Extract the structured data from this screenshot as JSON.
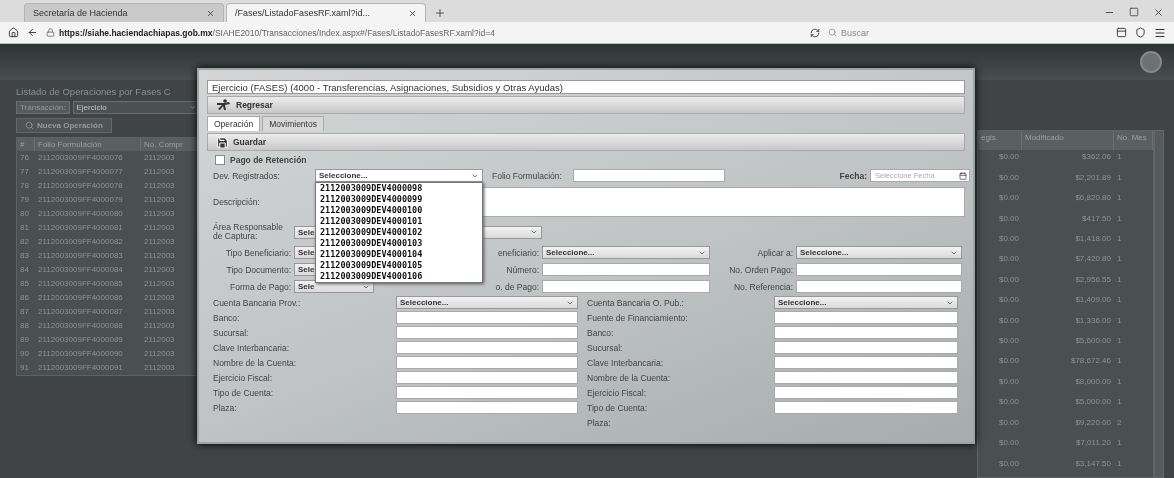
{
  "browser": {
    "tabs": [
      {
        "title": "Secretaría de Hacienda",
        "selected": false
      },
      {
        "title": "/Fases/ListadoFasesRF.xaml?id...",
        "selected": true
      }
    ],
    "url_host": "https://siahe.haciendachiapas.gob.mx",
    "url_path": "/SIAHE2010/Transacciones/Index.aspx#/Fases/ListadoFasesRF.xaml?id=4",
    "search_placeholder": "Buscar"
  },
  "page": {
    "heading": "Listado de Operaciones por Fases C",
    "filter_label": "Transacción:",
    "filter_value": "Ejercicio",
    "new_button": "Nueva Operación",
    "left_columns": [
      "#",
      "Folio Formulación",
      "No. Compr"
    ],
    "left_rows": [
      [
        "76",
        "2112003009FF4000076",
        "2112003"
      ],
      [
        "77",
        "2112003009FF4000077",
        "2112003"
      ],
      [
        "78",
        "2112003009FF4000078",
        "2112003"
      ],
      [
        "79",
        "2112003009FF4000079",
        "2112003"
      ],
      [
        "80",
        "2112003009FF4000080",
        "2112003"
      ],
      [
        "81",
        "2112003009FF4000081",
        "2112003"
      ],
      [
        "82",
        "2112003009FF4000082",
        "2112003"
      ],
      [
        "83",
        "2112003009FF4000083",
        "2112003"
      ],
      [
        "84",
        "2112003009FF4000084",
        "2112003"
      ],
      [
        "85",
        "2112003009FF4000085",
        "2112003"
      ],
      [
        "86",
        "2112003009FF4000086",
        "2112003"
      ],
      [
        "87",
        "2112003009FF4000087",
        "2112003"
      ],
      [
        "88",
        "2112003009FF4000088",
        "2112003"
      ],
      [
        "89",
        "2112003009FF4000089",
        "2112003"
      ],
      [
        "90",
        "2112003009FF4000090",
        "2112003"
      ],
      [
        "91",
        "2112003009FF4000091",
        "2112003"
      ]
    ],
    "right_columns": [
      "egis.",
      "Modificado",
      "No. Mes"
    ],
    "right_rows": [
      [
        "$0.00",
        "$362.06",
        "1"
      ],
      [
        "$0.00",
        "$2,201.89",
        "1"
      ],
      [
        "$0.00",
        "$6,820.80",
        "1"
      ],
      [
        "$0.00",
        "$417.50",
        "1"
      ],
      [
        "$0.00",
        "$1,418.00",
        "1"
      ],
      [
        "$0.00",
        "$7,420.80",
        "1"
      ],
      [
        "$0.00",
        "$2,956.55",
        "1"
      ],
      [
        "$0.00",
        "$1,409.00",
        "1"
      ],
      [
        "$0.00",
        "$1,336.00",
        "1"
      ],
      [
        "$0.00",
        "$5,600.00",
        "1"
      ],
      [
        "$0.00",
        "$78,672.46",
        "1"
      ],
      [
        "$0.00",
        "$8,000.00",
        "1"
      ],
      [
        "$0.00",
        "$5,000.00",
        "1"
      ],
      [
        "$0.00",
        "$9,220.00",
        "2"
      ],
      [
        "$0.00",
        "$7,011.20",
        "1"
      ],
      [
        "$0.00",
        "$3,147.50",
        "1"
      ]
    ]
  },
  "dialog": {
    "title": "Ejercicio (FASES) (4000 - Transferencias, Asignaciones, Subsidios y Otras Ayudas)",
    "back_button": "Regresar",
    "tabs": [
      {
        "label": "Operación",
        "selected": true
      },
      {
        "label": "Movimientos",
        "selected": false
      }
    ],
    "save_button": "Guardar",
    "retention": {
      "label": "Pago de Retención",
      "checked": false
    },
    "top_row": [
      {
        "label": "Dev. Registrados:",
        "field": {
          "kind": "select",
          "value": "Seleccione...",
          "expanded": true,
          "options": [
            "2112003009DEV4000098",
            "2112003009DEV4000099",
            "2112003009DEV4000100",
            "2112003009DEV4000101",
            "2112003009DEV4000102",
            "2112003009DEV4000103",
            "2112003009DEV4000104",
            "2112003009DEV4000105",
            "2112003009DEV4000106"
          ]
        }
      },
      {
        "label": "Folio Formulación:",
        "field": {
          "kind": "input"
        }
      },
      {
        "label": "Fecha:",
        "field": {
          "kind": "date",
          "placeholder": "Seleccione Fecha"
        }
      }
    ],
    "description_label": "Descripción:",
    "area": {
      "label": "Área Responsable de Captura:",
      "field": {
        "kind": "select",
        "value": "Sele"
      }
    },
    "rows": [
      [
        {
          "label": "Tipo Beneficiario:",
          "field": {
            "kind": "select",
            "value": "Sele"
          }
        },
        {
          "label": "eneficiario:",
          "field": {
            "kind": "select",
            "value": "Seleccione..."
          }
        },
        {
          "label": "Aplicar a:",
          "field": {
            "kind": "select",
            "value": "Seleccione..."
          }
        }
      ],
      [
        {
          "label": "Tipo Documento:",
          "field": {
            "kind": "select",
            "value": "Sele"
          }
        },
        {
          "label": "Número:",
          "field": {
            "kind": "input"
          }
        },
        {
          "label": "No. Orden Pago:",
          "field": {
            "kind": "input"
          }
        }
      ],
      [
        {
          "label": "Forma de Pago:",
          "field": {
            "kind": "select",
            "value": "Sele"
          }
        },
        {
          "label": "o. de Pago:",
          "field": {
            "kind": "input"
          }
        },
        {
          "label": "No. Referencia:",
          "field": {
            "kind": "input"
          }
        }
      ]
    ],
    "accounts": [
      {
        "label": "Cuenta Bancaria Prov.:",
        "field": {
          "kind": "select",
          "value": "Seleccione..."
        },
        "label_2": "Cuenta Bancaria O. Pub.:",
        "field_2": {
          "kind": "select",
          "value": "Seleccione..."
        }
      },
      {
        "label": "Banco:",
        "field": {
          "kind": "input"
        },
        "label_2": "Fuente de Financiamiento:",
        "field_2": {
          "kind": "input"
        }
      },
      {
        "label": "Sucursal:",
        "field": {
          "kind": "input"
        },
        "label_2": "Banco:",
        "field_2": {
          "kind": "input"
        }
      },
      {
        "label": "Clave Interbancaria:",
        "field": {
          "kind": "input"
        },
        "label_2": "Sucursal:",
        "field_2": {
          "kind": "input"
        }
      },
      {
        "label": "Nombre de la Cuenta:",
        "field": {
          "kind": "input"
        },
        "label_2": "Clave Interbancaria:",
        "field_2": {
          "kind": "input"
        }
      },
      {
        "label": "Ejercicio Fiscal:",
        "field": {
          "kind": "input"
        },
        "label_2": "Nombre de la Cuenta:",
        "field_2": {
          "kind": "input"
        }
      },
      {
        "label": "Tipo de Cuenta:",
        "field": {
          "kind": "input"
        },
        "label_2": "Ejercicio Fiscal:",
        "field_2": {
          "kind": "input"
        }
      },
      {
        "label": "Plaza:",
        "field": {
          "kind": "input"
        },
        "label_2": "Tipo de Cuenta:",
        "field_2": {
          "kind": "input"
        }
      },
      {
        "label_2": "Plaza:"
      }
    ]
  }
}
